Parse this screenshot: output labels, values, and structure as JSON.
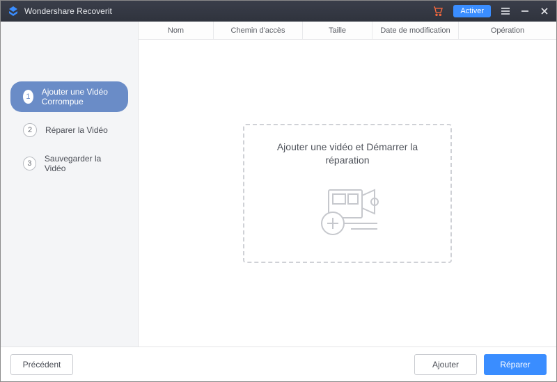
{
  "titlebar": {
    "app_name": "Wondershare Recoverit",
    "activate_label": "Activer"
  },
  "sidebar": {
    "steps": [
      {
        "num": "1",
        "label": "Ajouter une Vidéo Corrompue",
        "active": true
      },
      {
        "num": "2",
        "label": "Réparer la Vidéo",
        "active": false
      },
      {
        "num": "3",
        "label": "Sauvegarder la Vidéo",
        "active": false
      }
    ]
  },
  "table": {
    "headers": {
      "name": "Nom",
      "path": "Chemin d'accès",
      "size": "Taille",
      "modified": "Date de modification",
      "operation": "Opération"
    }
  },
  "dropzone": {
    "caption": "Ajouter une vidéo et Démarrer la réparation"
  },
  "footer": {
    "back_label": "Précédent",
    "add_label": "Ajouter",
    "repair_label": "Réparer"
  }
}
